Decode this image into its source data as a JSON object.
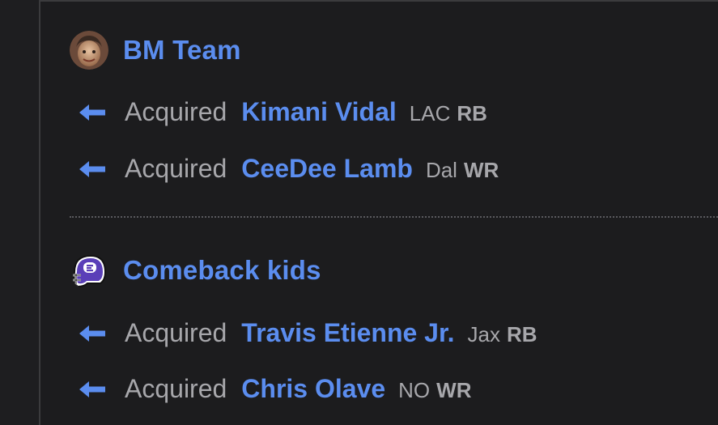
{
  "groups": [
    {
      "team_name": "BM Team",
      "avatar_icon": "person-avatar",
      "moves": [
        {
          "action": "Acquired",
          "player": "Kimani Vidal",
          "team": "LAC",
          "position": "RB"
        },
        {
          "action": "Acquired",
          "player": "CeeDee Lamb",
          "team": "Dal",
          "position": "WR"
        }
      ]
    },
    {
      "team_name": "Comeback kids",
      "avatar_icon": "football-helmet-icon",
      "moves": [
        {
          "action": "Acquired",
          "player": "Travis Etienne Jr.",
          "team": "Jax",
          "position": "RB"
        },
        {
          "action": "Acquired",
          "player": "Chris Olave",
          "team": "NO",
          "position": "WR"
        }
      ]
    }
  ],
  "colors": {
    "background": "#1c1c1e",
    "link_blue": "#5b8def",
    "muted_text": "#a7a7ab",
    "helmet_purple": "#5a3fb8"
  }
}
